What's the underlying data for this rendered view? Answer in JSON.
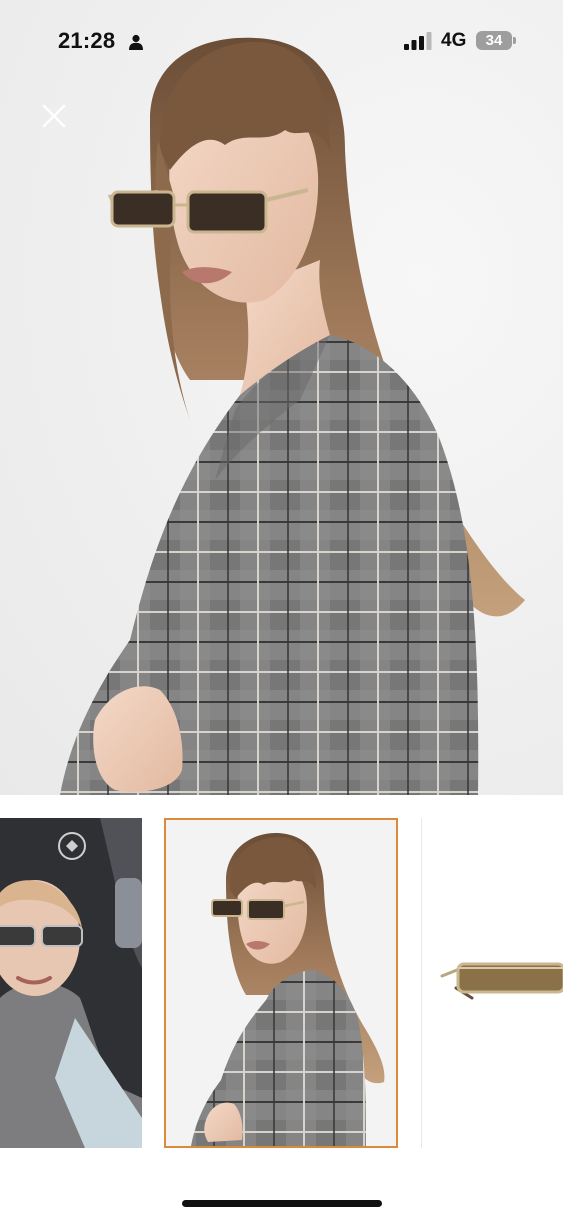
{
  "status_bar": {
    "time": "21:28",
    "network": "4G",
    "battery": "34"
  },
  "icons": {
    "close": "close-icon",
    "person": "person-icon",
    "signal": "signal-bars-icon",
    "battery": "battery-icon"
  },
  "gallery": {
    "selected_index": 1,
    "accent_color": "#d98a3a",
    "thumbnails": [
      {
        "name": "thumb-car-selfie"
      },
      {
        "name": "thumb-model-plaid"
      },
      {
        "name": "thumb-sunglasses-product"
      }
    ]
  }
}
